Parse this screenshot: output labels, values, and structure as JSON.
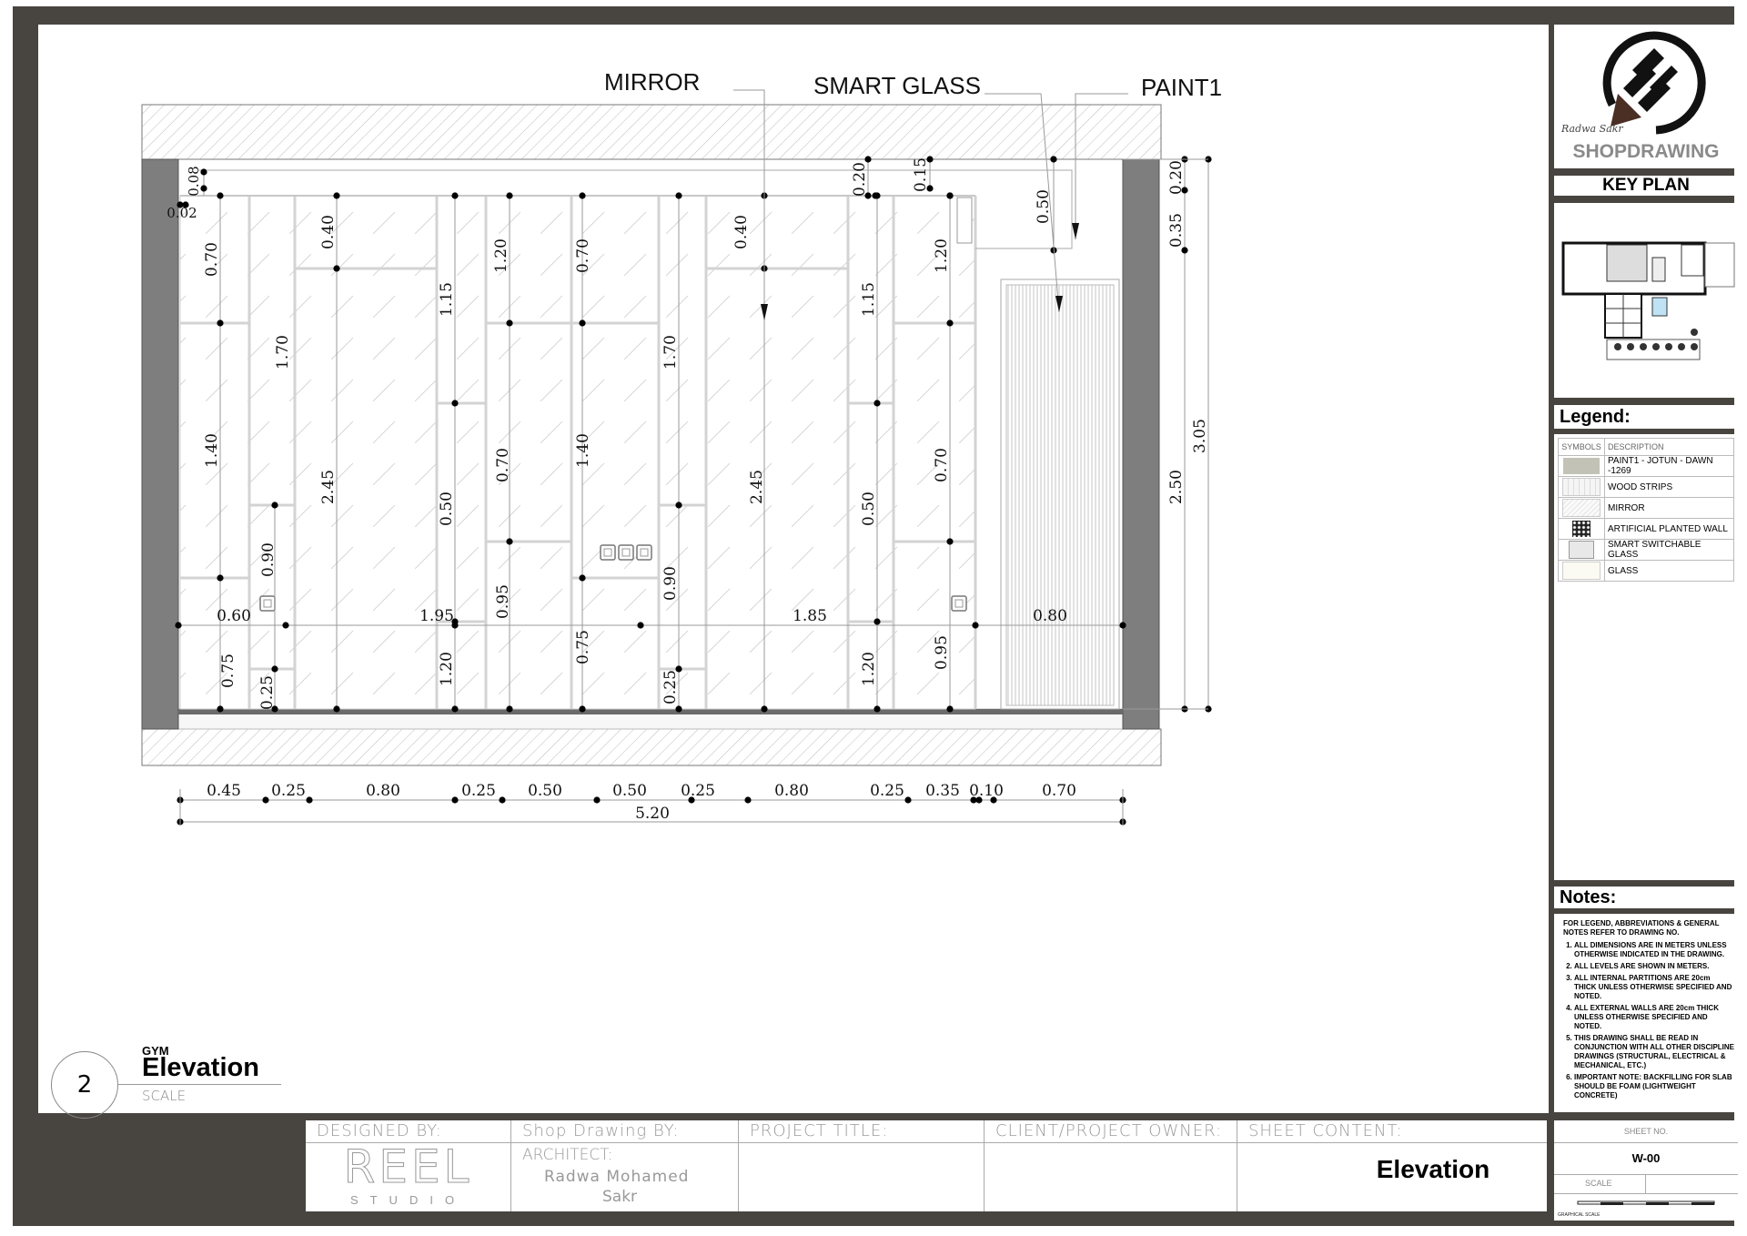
{
  "callouts": {
    "mirror": "MIRROR",
    "smart_glass": "SMART GLASS",
    "paint1": "PAINT1"
  },
  "elevation_dims": {
    "top_left": [
      "0.08",
      "0.02"
    ],
    "top_right": [
      "0.20",
      "0.15",
      "0.50"
    ],
    "vertical_labels": [
      "0.70",
      "0.40",
      "1.70",
      "1.40",
      "2.45",
      "0.90",
      "0.75",
      "0.25",
      "1.15",
      "1.20",
      "0.50",
      "0.70",
      "1.20",
      "0.95",
      "0.70",
      "1.40",
      "0.75",
      "1.70",
      "0.90",
      "0.25",
      "0.40",
      "2.45",
      "1.15",
      "1.20",
      "0.50",
      "0.70",
      "1.20",
      "0.95"
    ],
    "horizontal_mid": [
      "0.60",
      "1.95",
      "1.85",
      "0.80"
    ],
    "right_chain": [
      "0.20",
      "0.35",
      "2.50"
    ],
    "right_total": "3.05",
    "bottom_chain": [
      "0.45",
      "0.25",
      "0.80",
      "0.25",
      "0.50",
      "0.50",
      "0.25",
      "0.80",
      "0.25",
      "0.35",
      "0.10",
      "0.70"
    ],
    "bottom_total": "5.20"
  },
  "view_title": {
    "number": "2",
    "subtitle": "GYM",
    "title": "Elevation",
    "scale_label": "SCALE"
  },
  "logo": {
    "script_text": "Radwa Sakr",
    "brand_text": "SHOPDRAWING"
  },
  "key_plan": {
    "title": "KEY PLAN"
  },
  "legend": {
    "title": "Legend:",
    "col_symbols": "SYMBOLS",
    "col_description": "DESCRIPTION",
    "items": [
      {
        "label": "PAINT1 - JOTUN - DAWN -1269",
        "color": "#c2c3b6"
      },
      {
        "label": "WOOD STRIPS",
        "color": "#f3f3f3"
      },
      {
        "label": "MIRROR",
        "color": "#f7f7f7"
      },
      {
        "label": "ARTIFICIAL PLANTED WALL",
        "color": "#222222"
      },
      {
        "label": "SMART SWITCHABLE GLASS",
        "color": "#e8e8e8"
      },
      {
        "label": "GLASS",
        "color": "#fbfbf3"
      }
    ]
  },
  "notes": {
    "title": "Notes:",
    "intro": "FOR LEGEND, ABBREVIATIONS & GENERAL NOTES REFER TO DRAWING NO.",
    "items": [
      "ALL DIMENSIONS ARE IN METERS UNLESS OTHERWISE INDICATED IN THE DRAWING.",
      "ALL LEVELS ARE SHOWN IN METERS.",
      "ALL INTERNAL PARTITIONS ARE 20cm THICK UNLESS OTHERWISE SPECIFIED AND NOTED.",
      "ALL EXTERNAL WALLS ARE 20cm THICK UNLESS OTHERWISE SPECIFIED AND NOTED.",
      "THIS DRAWING SHALL BE READ IN CONJUNCTION WITH ALL OTHER DISCIPLINE DRAWINGS (STRUCTURAL, ELECTRICAL & MECHANICAL, ETC.)",
      "IMPORTANT NOTE: BACKFILLING FOR SLAB SHOULD BE FOAM (LIGHTWEIGHT CONCRETE)"
    ]
  },
  "title_block": {
    "designed_by_label": "DESIGNED BY:",
    "designer_logo": "REEL",
    "designer_sub": "STUDIO",
    "shop_drawing_label": "Shop Drawing BY:",
    "architect_label": "ARCHITECT:",
    "architect_name_1": "Radwa Mohamed",
    "architect_name_2": "Sakr",
    "project_title_label": "PROJECT TITLE:",
    "project_title": "",
    "client_label": "CLIENT/PROJECT OWNER:",
    "client": "",
    "sheet_content_label": "SHEET CONTENT:",
    "sheet_content": "Elevation"
  },
  "sheet": {
    "sheet_no_label": "SHEET NO.",
    "sheet_no": "W-00",
    "scale_label": "SCALE",
    "graphical_scale_label": "GRAPHICAL SCALE"
  }
}
